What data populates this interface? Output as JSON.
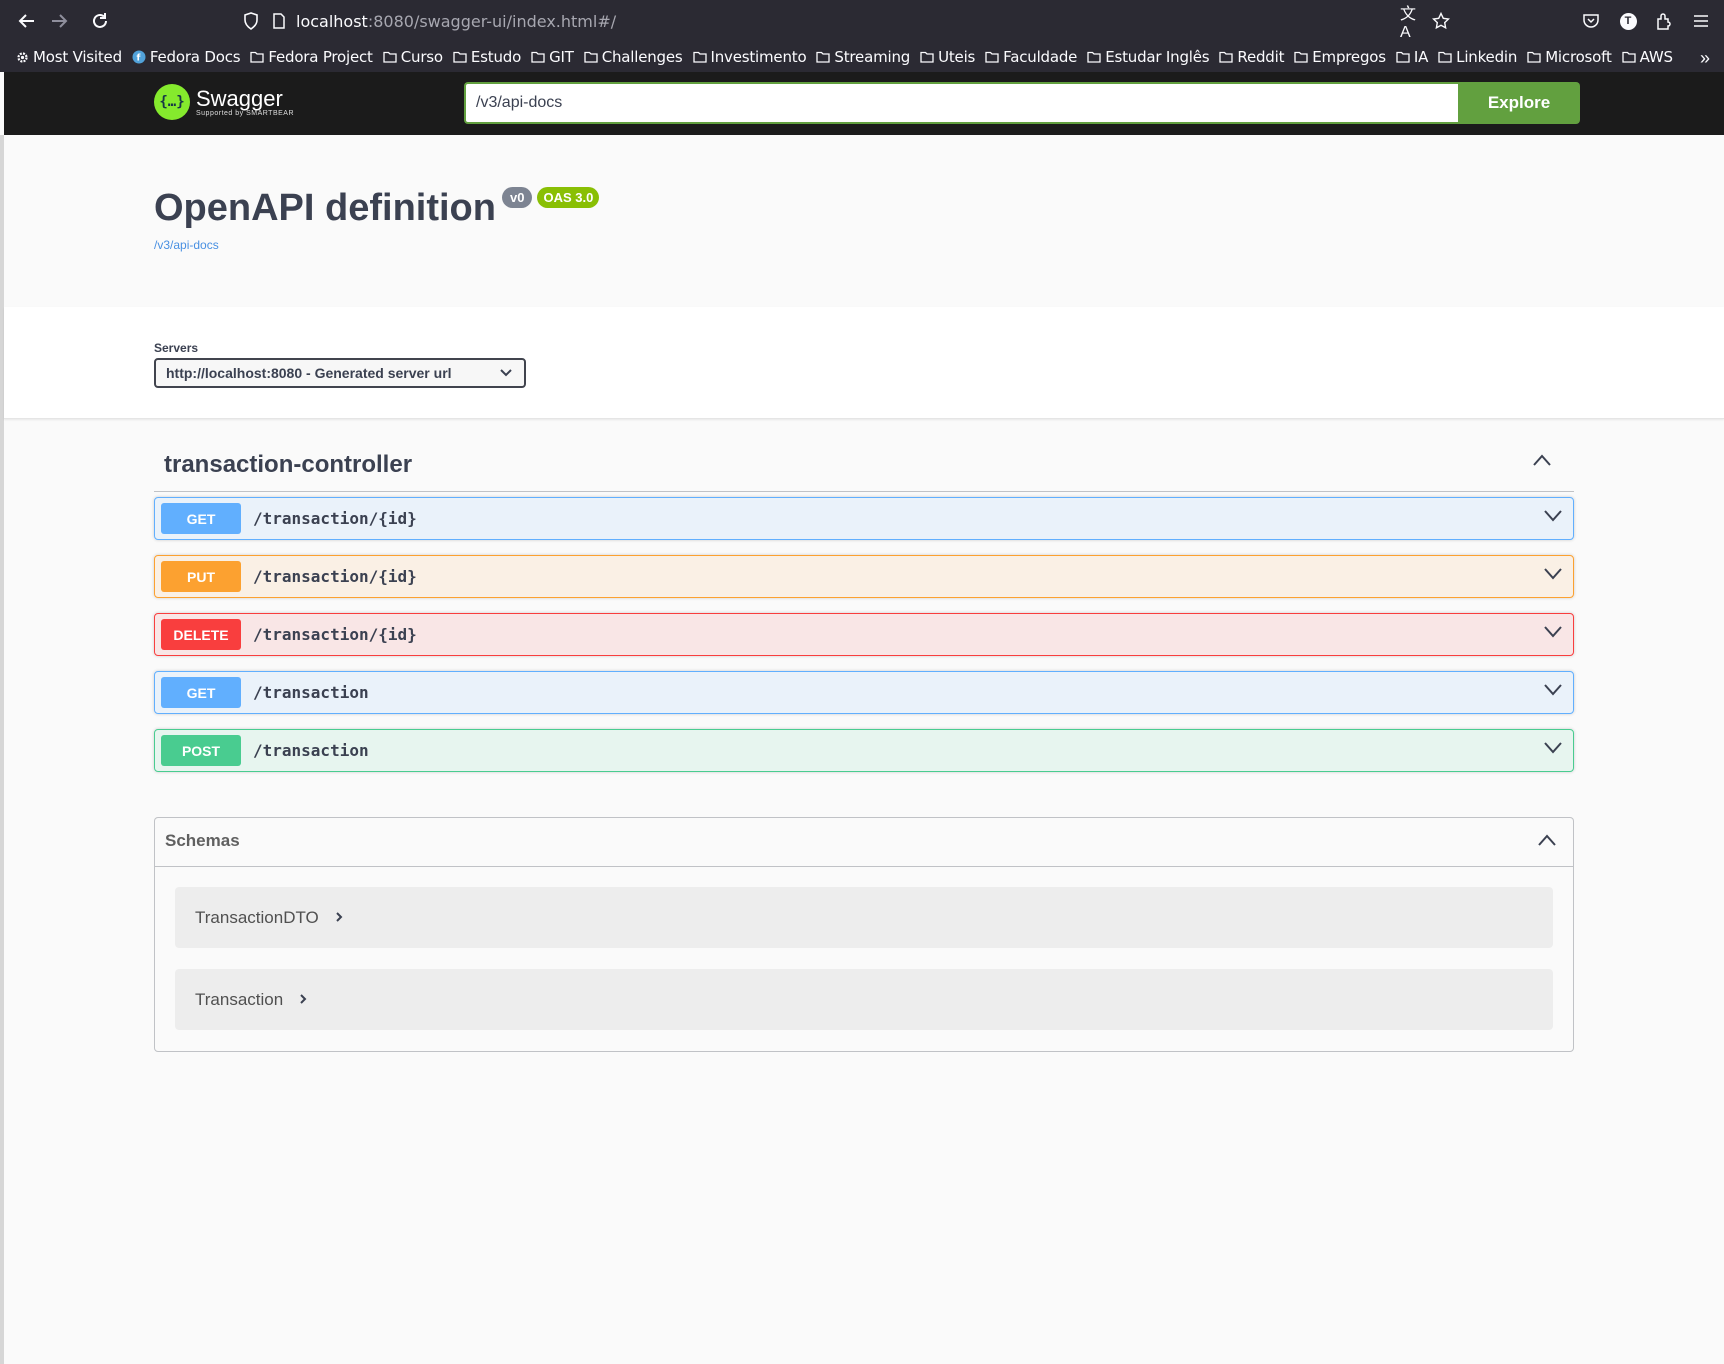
{
  "browser": {
    "url_host": "localhost",
    "url_rest": ":8080/swagger-ui/index.html#/",
    "bookmarks": [
      "Most Visited",
      "Fedora Docs",
      "Fedora Project",
      "Curso",
      "Estudo",
      "GIT",
      "Challenges",
      "Investimento",
      "Streaming",
      "Uteis",
      "Faculdade",
      "Estudar Inglês",
      "Reddit",
      "Empregos",
      "IA",
      "Linkedin",
      "Microsoft",
      "AWS"
    ]
  },
  "topbar": {
    "logo_title": "Swagger",
    "logo_sub": "Supported by SMARTBEAR",
    "spec_url": "/v3/api-docs",
    "explore_label": "Explore"
  },
  "info": {
    "title": "OpenAPI definition",
    "version": "v0",
    "oas": "OAS 3.0",
    "link": "/v3/api-docs"
  },
  "servers": {
    "label": "Servers",
    "selected": "http://localhost:8080 - Generated server url"
  },
  "tag": {
    "name": "transaction-controller"
  },
  "operations": [
    {
      "method": "GET",
      "path": "/transaction/{id}"
    },
    {
      "method": "PUT",
      "path": "/transaction/{id}"
    },
    {
      "method": "DELETE",
      "path": "/transaction/{id}"
    },
    {
      "method": "GET",
      "path": "/transaction"
    },
    {
      "method": "POST",
      "path": "/transaction"
    }
  ],
  "schemas": {
    "title": "Schemas",
    "items": [
      "TransactionDTO",
      "Transaction"
    ]
  },
  "colors": {
    "get": "#61affe",
    "put": "#fca130",
    "delete": "#f93e3e",
    "post": "#49cc90",
    "explore": "#62a03f",
    "swagger_green": "#85ea2d"
  }
}
